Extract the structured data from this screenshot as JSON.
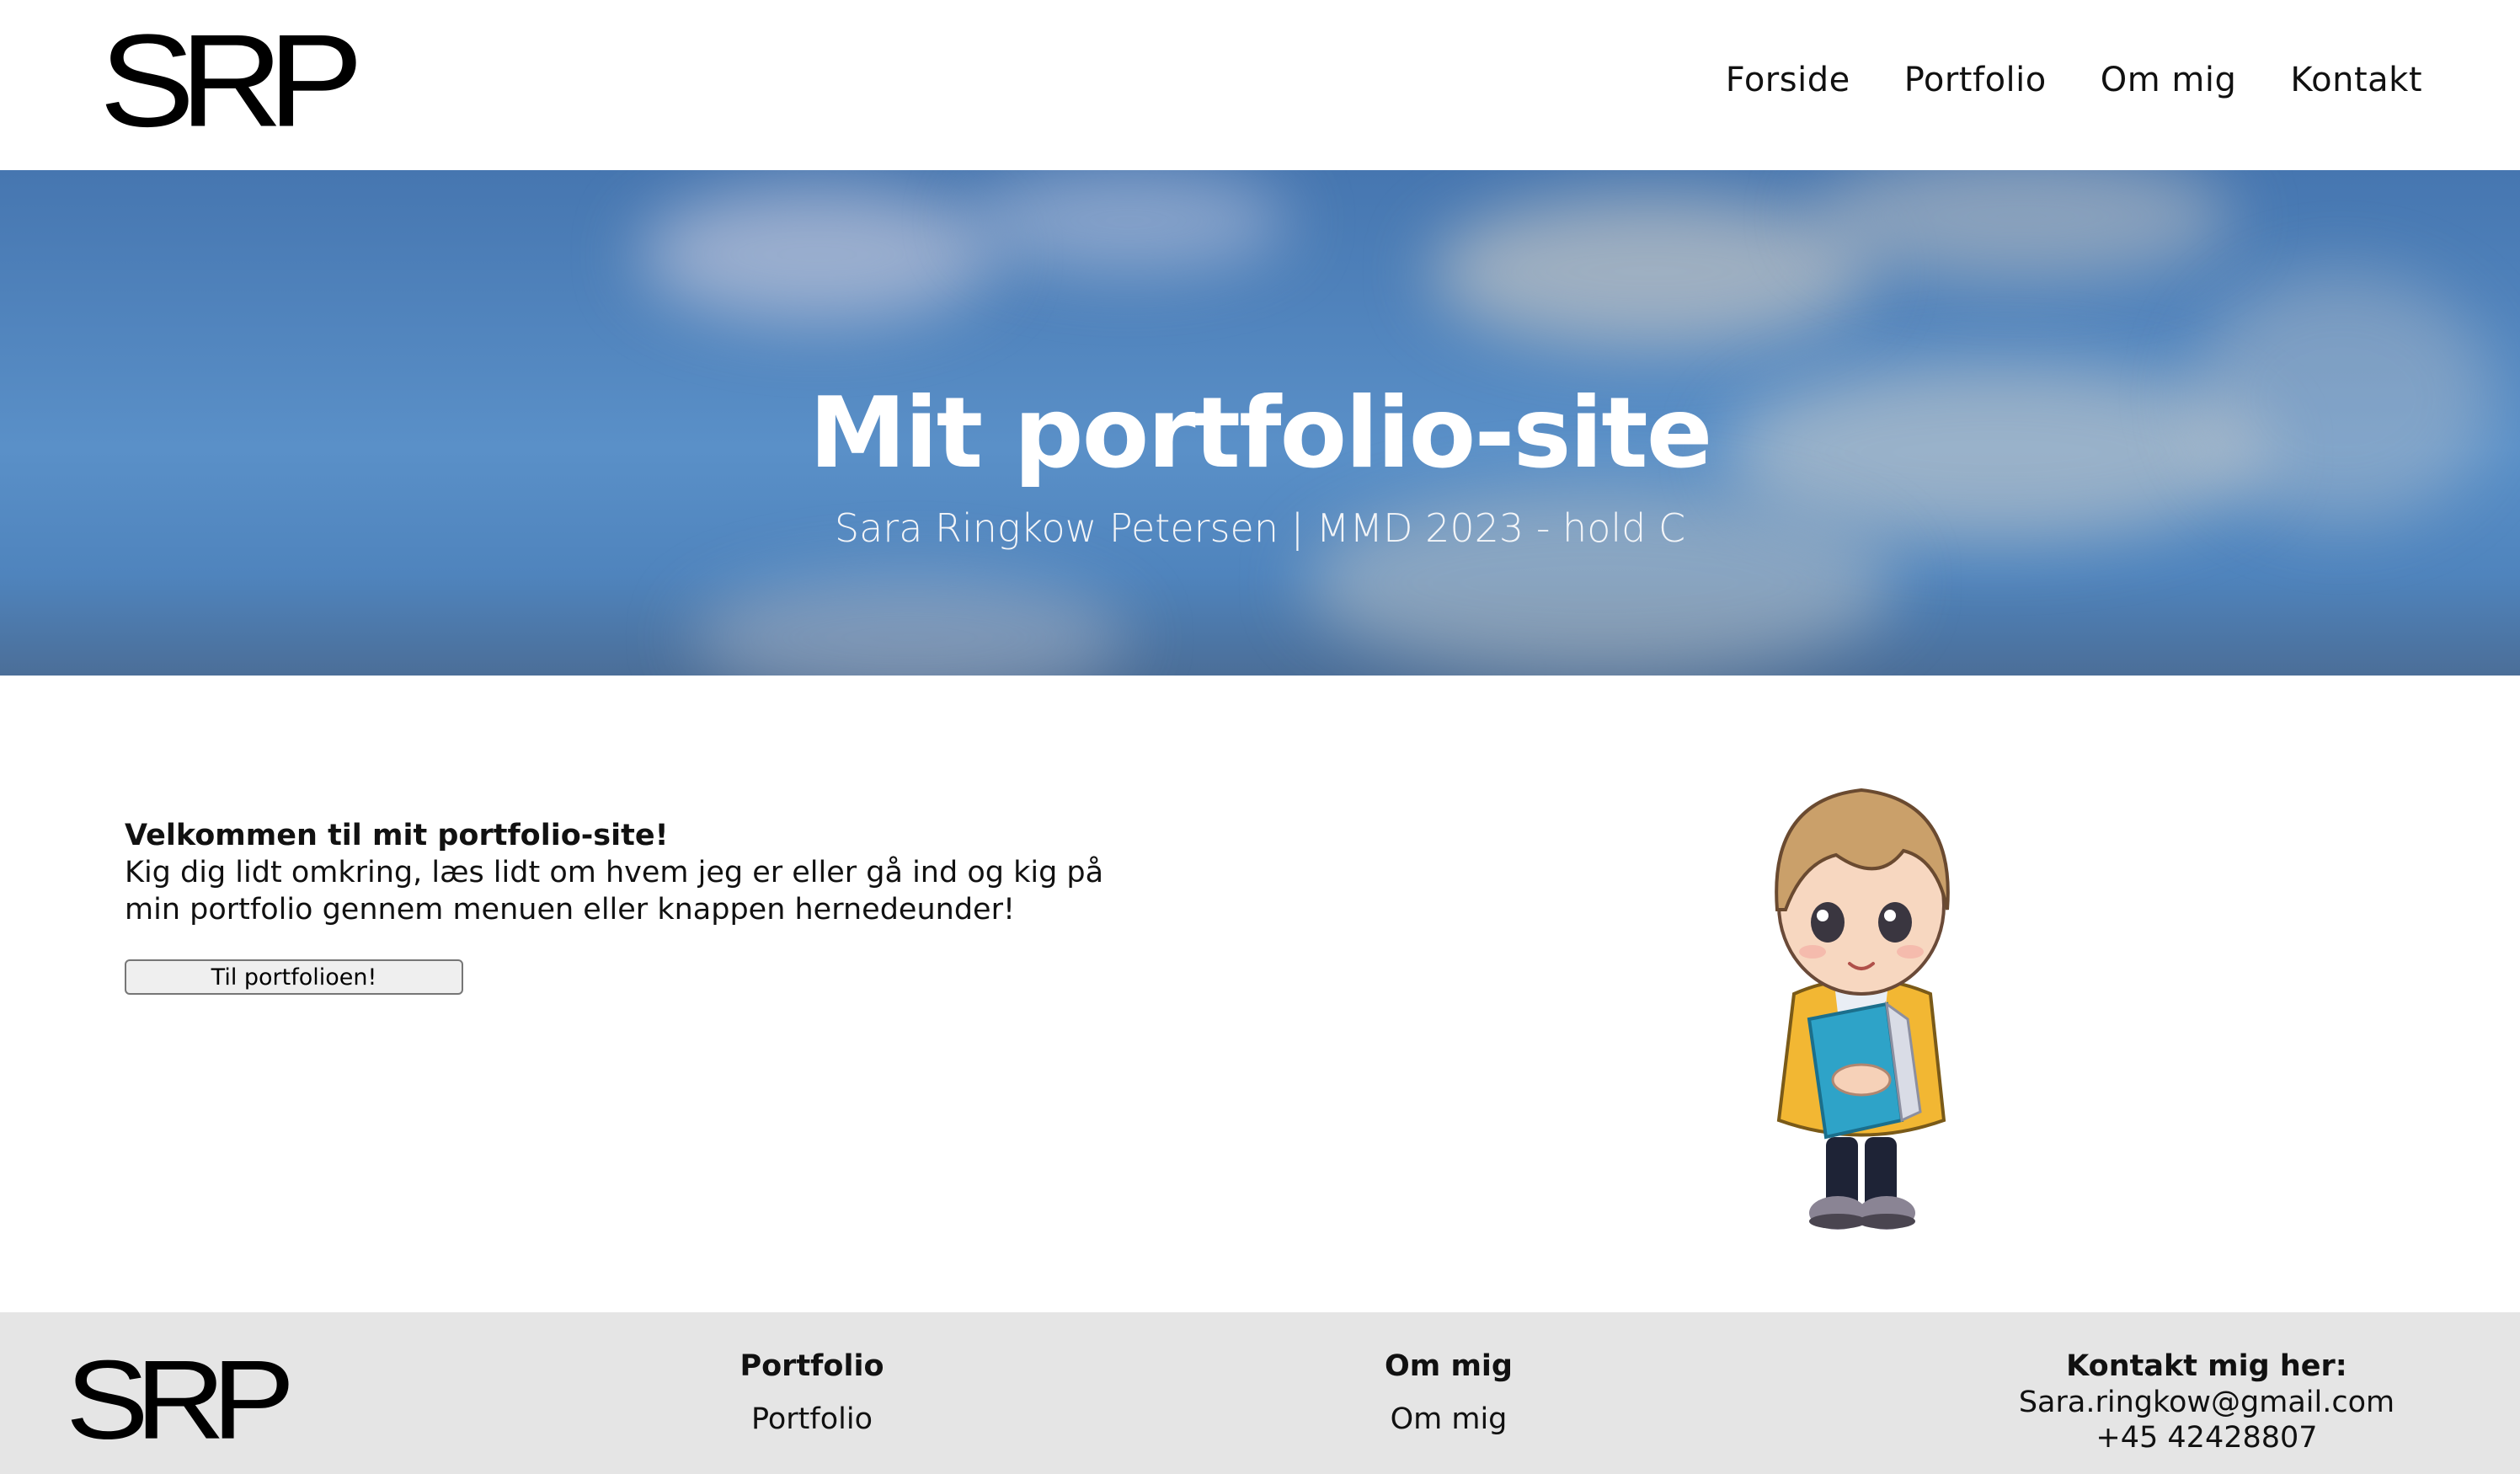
{
  "header": {
    "logo": "SRP",
    "nav": [
      "Forside",
      "Portfolio",
      "Om mig",
      "Kontakt"
    ]
  },
  "hero": {
    "title": "Mit portfolio-site",
    "subtitle": "Sara Ringkow Petersen | MMD 2023 - hold C"
  },
  "intro": {
    "heading": "Velkommen til mit portfolio-site!",
    "text": "Kig dig lidt omkring, læs lidt om hvem jeg er eller gå ind og kig på min portfolio gennem menuen eller knappen hernedeunder!",
    "button_label": "Til portfolioen!"
  },
  "footer": {
    "logo": "SRP",
    "portfolio": {
      "title": "Portfolio",
      "link": "Portfolio"
    },
    "om_mig": {
      "title": "Om mig",
      "link": "Om mig"
    },
    "kontakt": {
      "title": "Kontakt mig her:",
      "email": "Sara.ringkow@gmail.com",
      "phone": "+45 42428807"
    }
  },
  "colors": {
    "hero_blue": "#5a90c8",
    "footer_bg": "#e5e5e5",
    "text": "#111111"
  }
}
